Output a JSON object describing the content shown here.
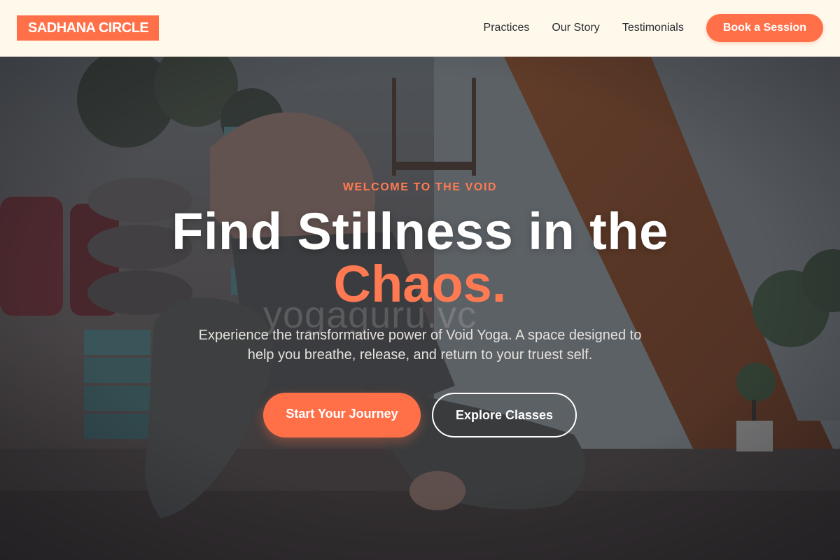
{
  "brand": {
    "logo_text": "SADHANA CIRCLE",
    "accent_color": "#ff7049"
  },
  "nav": {
    "links": [
      {
        "label": "Practices"
      },
      {
        "label": "Our Story"
      },
      {
        "label": "Testimonials"
      }
    ],
    "cta_label": "Book a Session"
  },
  "hero": {
    "eyebrow": "WELCOME TO THE VOID",
    "headline": "Find Stillness in the",
    "headline_accent": "Chaos.",
    "watermark": "yogaguru.vc",
    "subtitle": "Experience the transformative power of Void Yoga. A space designed to help you breathe, release, and return to your truest self.",
    "primary_cta": "Start Your Journey",
    "secondary_cta": "Explore Classes",
    "background_image": "yoga-studio-photo"
  }
}
